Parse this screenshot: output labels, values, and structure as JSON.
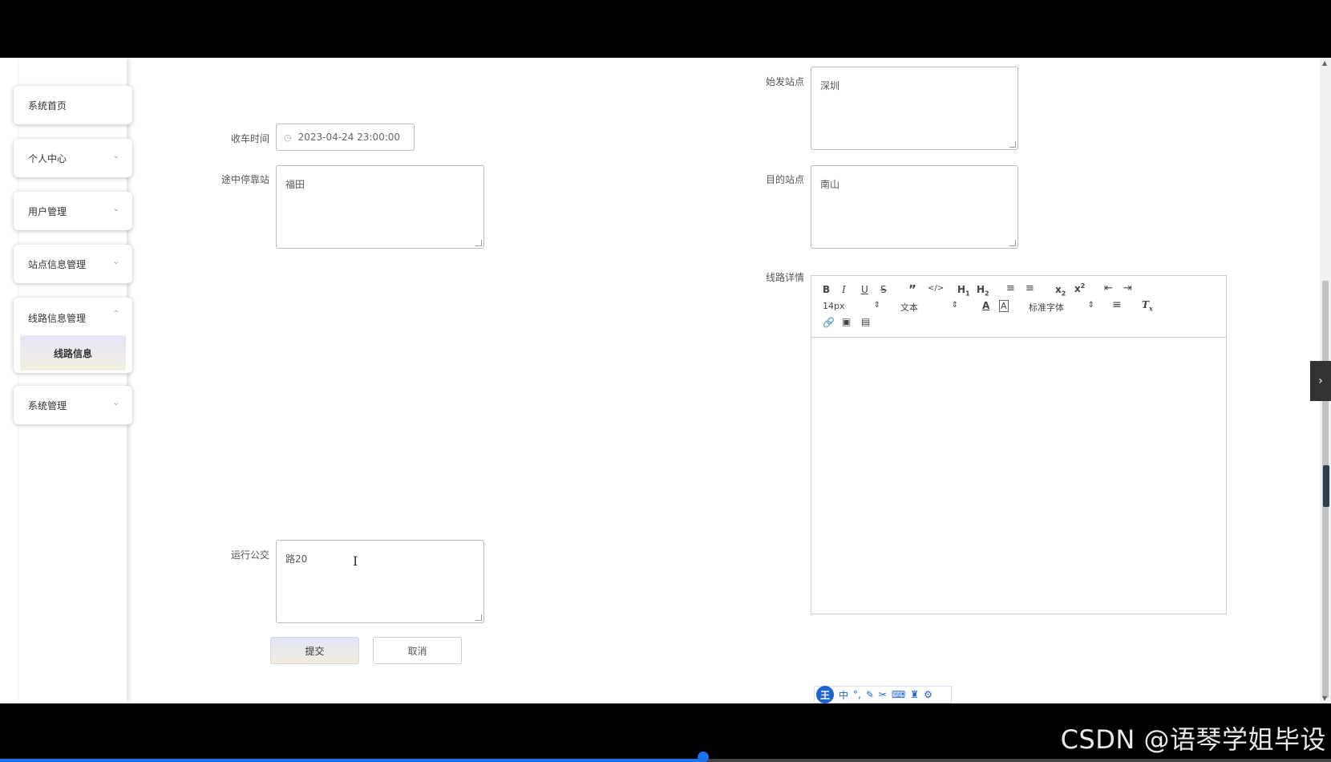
{
  "sidebar": {
    "items": [
      {
        "label": "系统首页",
        "has_chevron": false
      },
      {
        "label": "个人中心",
        "has_chevron": true
      },
      {
        "label": "用户管理",
        "has_chevron": true
      },
      {
        "label": "站点信息管理",
        "has_chevron": true
      },
      {
        "label": "线路信息管理",
        "has_chevron": true,
        "expanded": true,
        "children": [
          {
            "label": "线路信息",
            "active": true
          }
        ]
      },
      {
        "label": "系统管理",
        "has_chevron": true
      }
    ]
  },
  "form": {
    "end_time": {
      "label": "收车时间",
      "value": "2023-04-24 23:00:00"
    },
    "stops": {
      "label": "途中停靠站",
      "value": "福田"
    },
    "bus": {
      "label": "运行公交",
      "value": "路20"
    },
    "start_station": {
      "label": "始发站点",
      "value": "深圳"
    },
    "destination": {
      "label": "目的站点",
      "value": "南山"
    },
    "details": {
      "label": "线路详情",
      "value": ""
    }
  },
  "editor": {
    "font_size": "14px",
    "block_type": "文本",
    "font_family": "标准字体"
  },
  "buttons": {
    "submit": "提交",
    "cancel": "取消"
  },
  "ime": {
    "logo": "王",
    "mode": "中"
  },
  "watermark": "CSDN @语琴学姐毕设",
  "colors": {
    "accent": "#1a73e8",
    "submit_gradient_top": "#e0e4f5",
    "submit_gradient_bottom": "#f2ecdf"
  }
}
